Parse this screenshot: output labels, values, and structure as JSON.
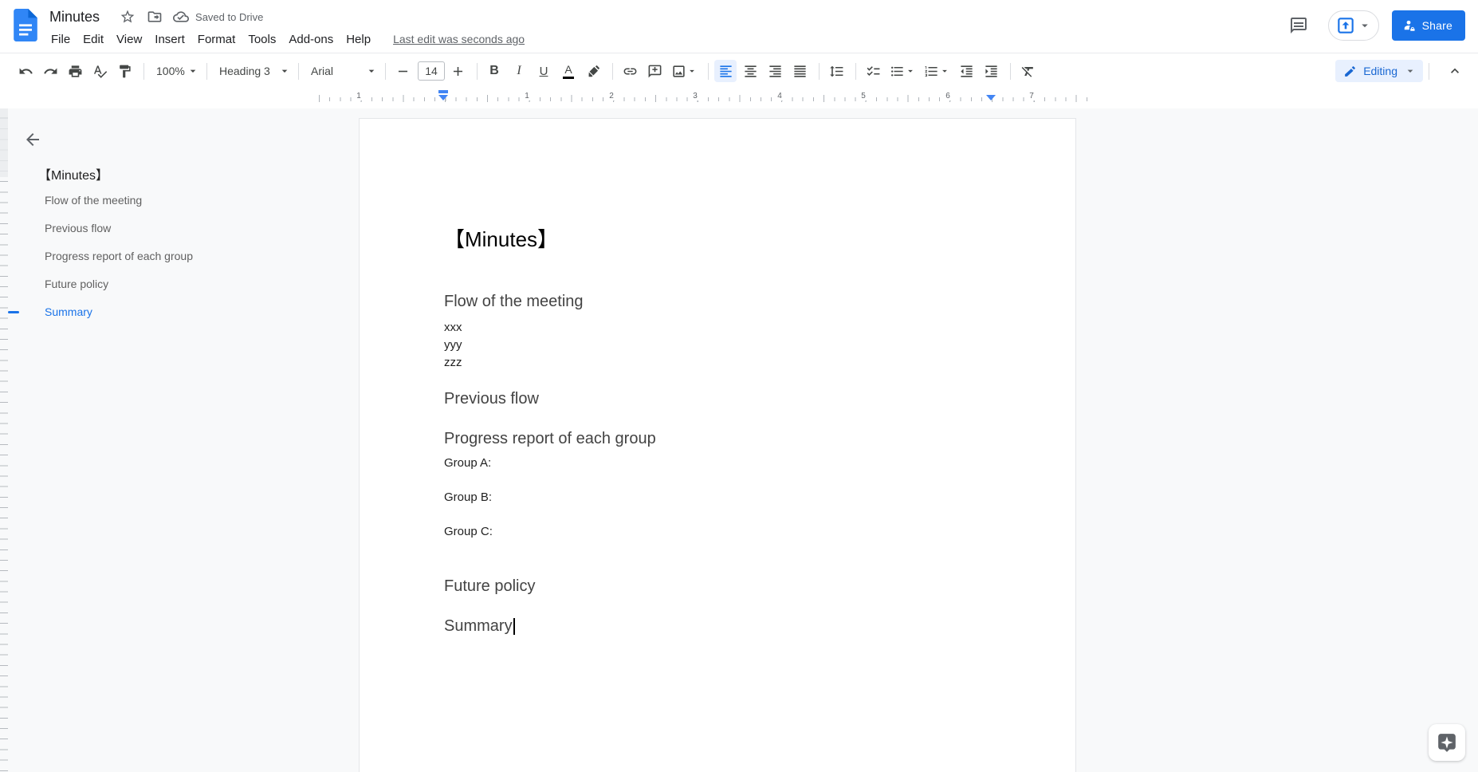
{
  "header": {
    "title": "Minutes",
    "saved_status": "Saved to Drive",
    "last_edit": "Last edit was seconds ago",
    "share_label": "Share",
    "menus": {
      "file": "File",
      "edit": "Edit",
      "view": "View",
      "insert": "Insert",
      "format": "Format",
      "tools": "Tools",
      "addons": "Add-ons",
      "help": "Help"
    }
  },
  "toolbar": {
    "zoom_value": "100%",
    "style_value": "Heading 3",
    "font_value": "Arial",
    "font_size_value": "14",
    "mode_label": "Editing"
  },
  "outline": {
    "title": "【Minutes】",
    "items": [
      "Flow of the meeting",
      "Previous flow",
      "Progress report of each group",
      "Future policy",
      "Summary"
    ],
    "active_item": "Summary"
  },
  "document": {
    "title": "【Minutes】",
    "heading_flow": "Flow of the meeting",
    "flow_line_1": "xxx",
    "flow_line_2": "yyy",
    "flow_line_3": "zzz",
    "heading_previous": "Previous flow",
    "heading_progress": "Progress report of each group",
    "group_a": "Group A:",
    "group_b": "Group B:",
    "group_c": "Group C:",
    "heading_future": "Future policy",
    "heading_summary": "Summary"
  },
  "ruler": {
    "marks": [
      "1",
      "1",
      "2",
      "3",
      "4",
      "5",
      "6",
      "7"
    ]
  },
  "colors": {
    "accent_blue": "#1a73e8",
    "editing_chip_bg": "#e8f0fe",
    "editing_chip_text": "#1967d2",
    "icon_gray": "#444746",
    "heading_gray": "#434343",
    "outline_item_gray": "#616161",
    "canvas_bg": "#f8f9fa",
    "marker_blue": "#4285f4",
    "logo_blue": "#3086f6"
  },
  "icons": {
    "dropdown_caret": "▾",
    "collapse_chevron": "^",
    "back_arrow": "←"
  }
}
